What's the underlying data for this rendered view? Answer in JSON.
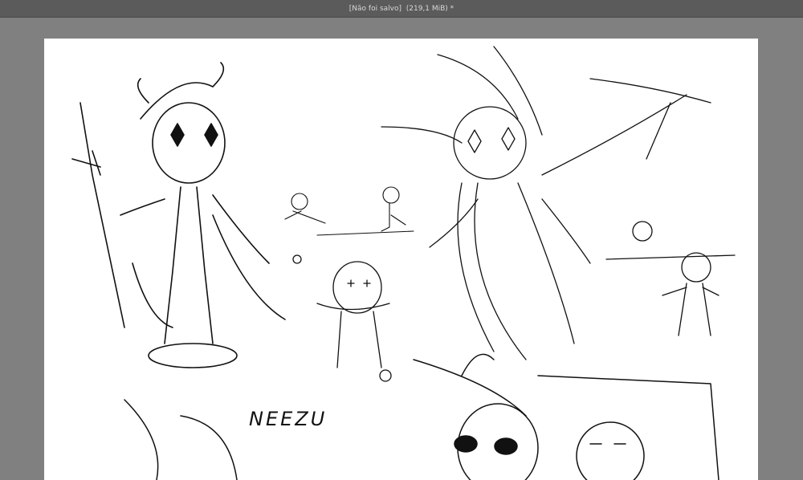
{
  "window": {
    "title": "[Não foi salvo]  (219,1 MiB) *"
  },
  "canvas": {
    "background_color": "#ffffff",
    "artwork_lettering": "NEEZU"
  }
}
